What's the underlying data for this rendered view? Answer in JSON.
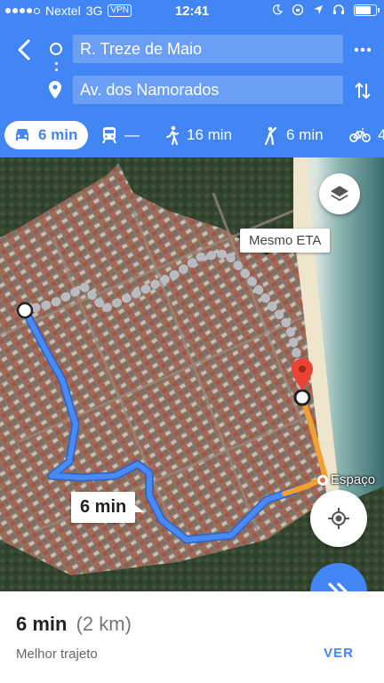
{
  "status_bar": {
    "carrier": "Nextel",
    "network": "3G",
    "vpn": "VPN",
    "time": "12:41"
  },
  "route": {
    "from": "R. Treze de Maio",
    "to": "Av. dos Namorados"
  },
  "modes": [
    {
      "name": "car",
      "icon": "car-icon",
      "label": "6 min",
      "selected": true
    },
    {
      "name": "transit",
      "icon": "train-icon",
      "label": "—"
    },
    {
      "name": "walk",
      "icon": "walking-icon",
      "label": "16 min"
    },
    {
      "name": "ride",
      "icon": "ride-icon",
      "label": "6 min"
    },
    {
      "name": "bike",
      "icon": "bicycle-icon",
      "label": "4"
    }
  ],
  "map": {
    "eta_label": "Mesmo ETA",
    "route_time_label": "6 min",
    "poi_label": "Espaço"
  },
  "summary": {
    "duration": "6 min",
    "distance": "(2 km)",
    "subtitle": "Melhor trajeto",
    "action": "VER"
  },
  "colors": {
    "header": "#4285f4",
    "route_primary": "#4a8af4",
    "route_traffic": "#f4a030",
    "route_alternate": "#b8bcc2",
    "destination_pin": "#ea4335"
  }
}
